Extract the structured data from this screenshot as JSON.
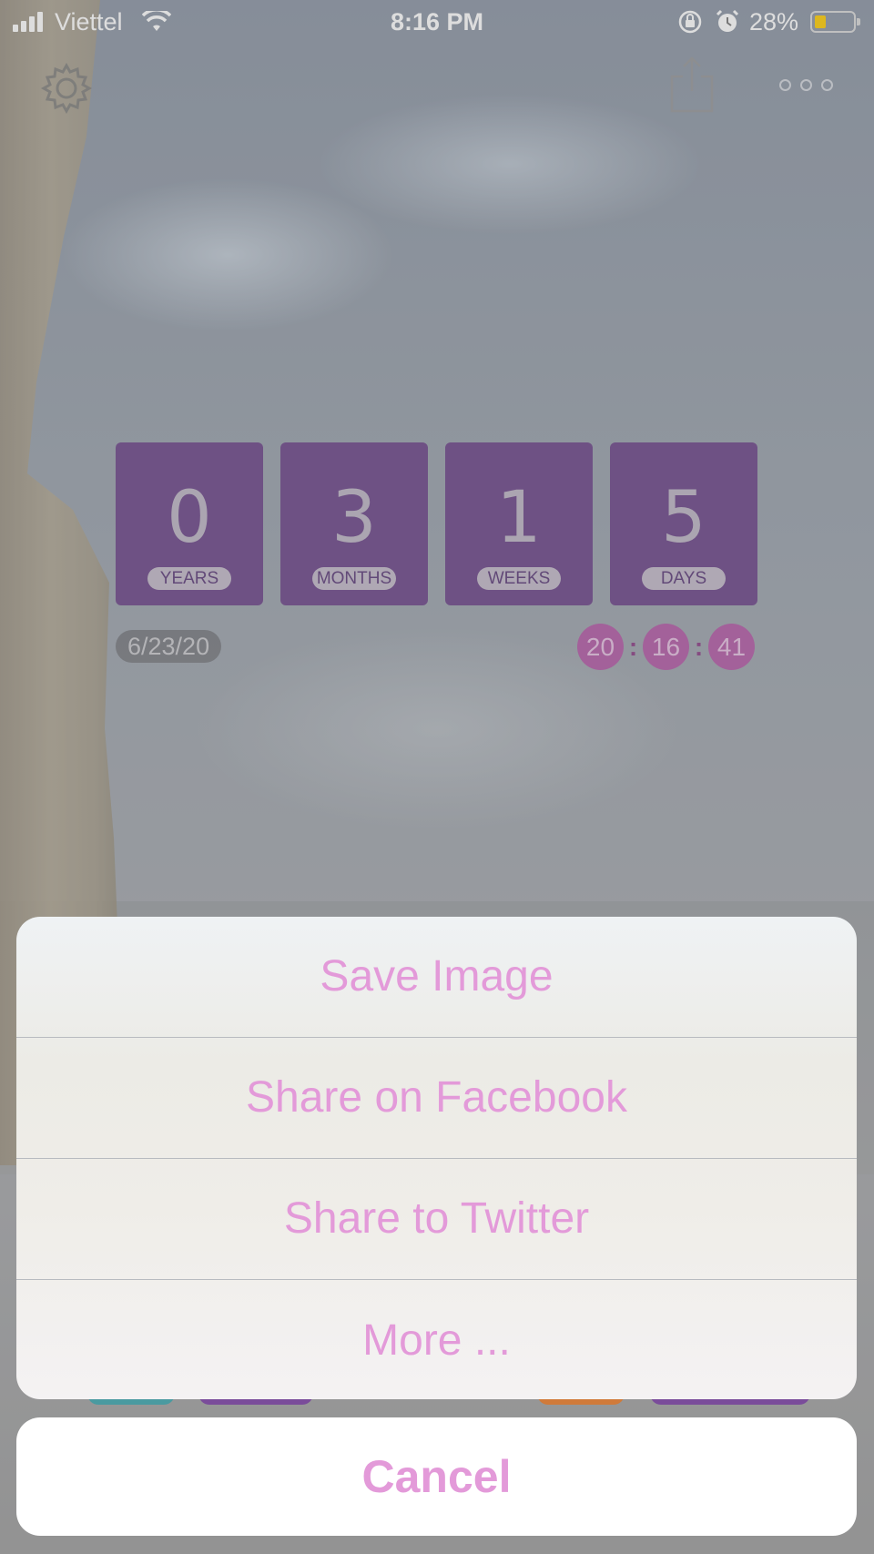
{
  "status_bar": {
    "carrier": "Viettel",
    "time": "8:16 PM",
    "battery_percent": "28%",
    "battery_level": 0.28,
    "battery_color": "#ffcc00"
  },
  "toolbar": {
    "settings_icon": "gear-icon",
    "share_icon": "share-icon",
    "more_icon": "ellipsis-icon"
  },
  "countdown": {
    "units": [
      {
        "value": "0",
        "label": "YEARS"
      },
      {
        "value": "3",
        "label": "MONTHS"
      },
      {
        "value": "1",
        "label": "WEEKS"
      },
      {
        "value": "5",
        "label": "DAYS"
      }
    ],
    "date": "6/23/20",
    "clock": {
      "hours": "20",
      "minutes": "16",
      "seconds": "41"
    },
    "tile_color": "#6b4488",
    "clock_color": "#b25aa6"
  },
  "action_sheet": {
    "options": [
      "Save Image",
      "Share on Facebook",
      "Share to Twitter",
      "More ..."
    ],
    "cancel": "Cancel",
    "accent_color": "#e39ad9"
  }
}
